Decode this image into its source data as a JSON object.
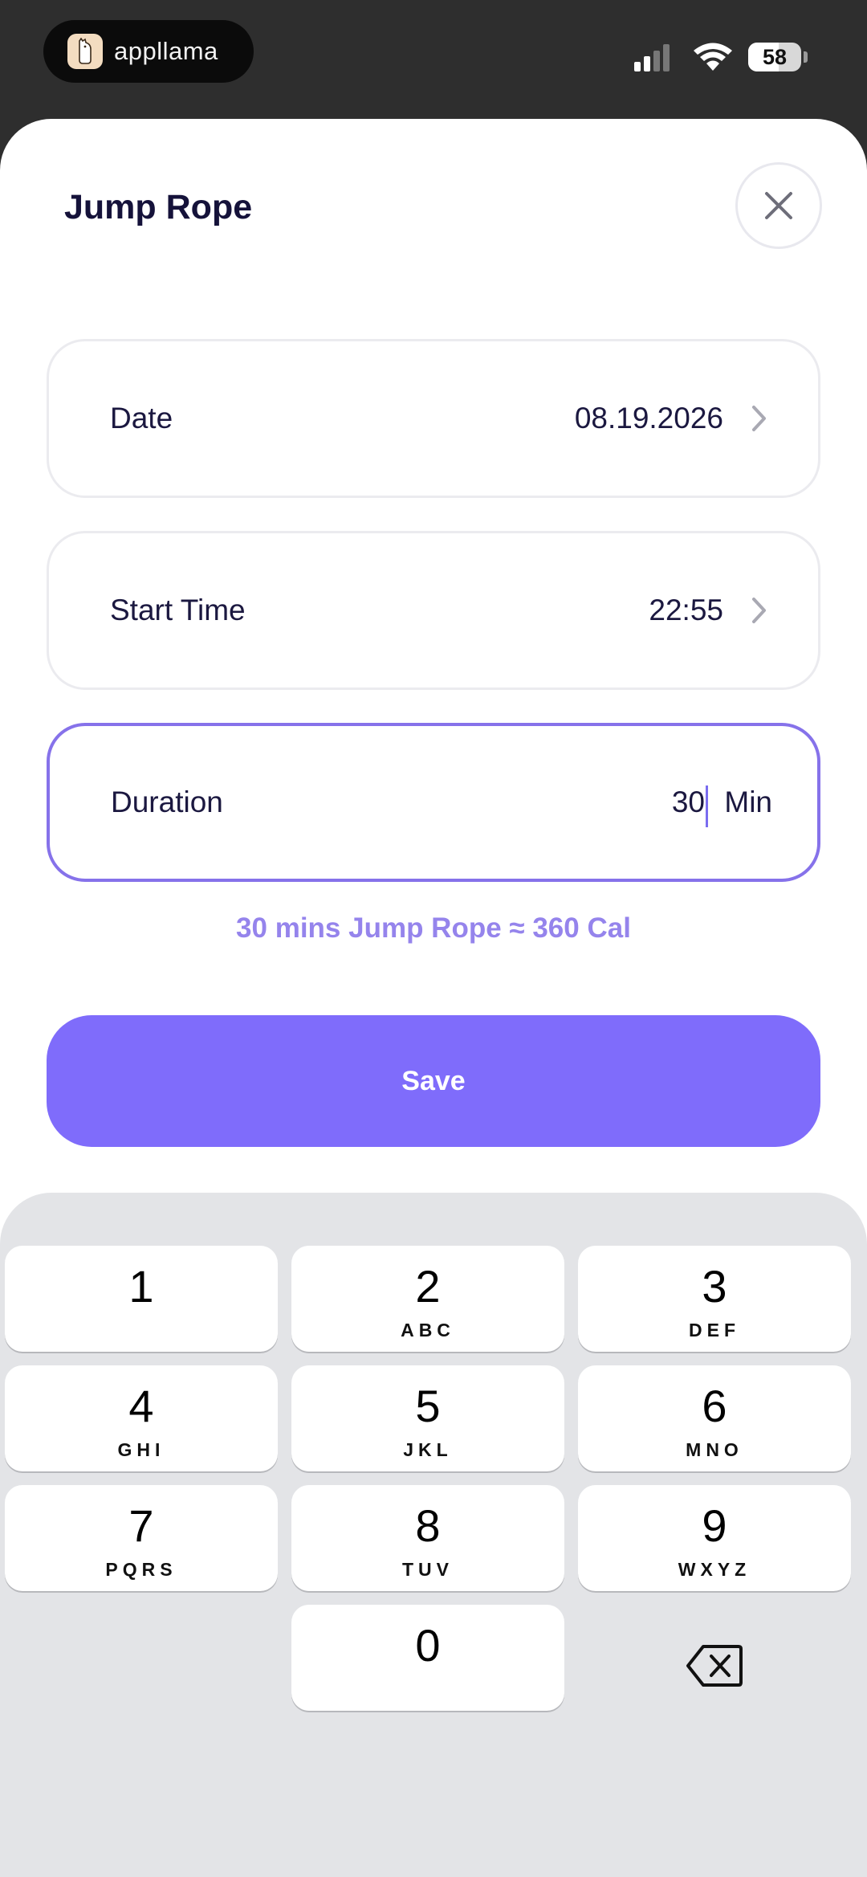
{
  "status_bar": {
    "app_name": "appllama",
    "battery": "58",
    "battery_level": 0.58
  },
  "sheet": {
    "title": "Jump Rope",
    "fields": {
      "date": {
        "label": "Date",
        "value": "08.19.2026"
      },
      "start_time": {
        "label": "Start Time",
        "value": "22:55"
      },
      "duration": {
        "label": "Duration",
        "value": "30",
        "unit": "Min"
      }
    },
    "hint": "30 mins Jump Rope ≈ 360 Cal",
    "save_label": "Save"
  },
  "keypad": {
    "keys": [
      {
        "digit": "1",
        "letters": ""
      },
      {
        "digit": "2",
        "letters": "ABC"
      },
      {
        "digit": "3",
        "letters": "DEF"
      },
      {
        "digit": "4",
        "letters": "GHI"
      },
      {
        "digit": "5",
        "letters": "JKL"
      },
      {
        "digit": "6",
        "letters": "MNO"
      },
      {
        "digit": "7",
        "letters": "PQRS"
      },
      {
        "digit": "8",
        "letters": "TUV"
      },
      {
        "digit": "9",
        "letters": "WXYZ"
      },
      {
        "digit": "0",
        "letters": ""
      }
    ]
  },
  "colors": {
    "accent": "#7f6cfb",
    "title_text": "#15123a",
    "hint_text": "#9584ec"
  },
  "icons": {
    "close": "close-icon",
    "chevron": "chevron-right-icon",
    "delete": "backspace-icon",
    "signal": "cellular-signal-icon",
    "wifi": "wifi-icon",
    "battery": "battery-icon"
  }
}
